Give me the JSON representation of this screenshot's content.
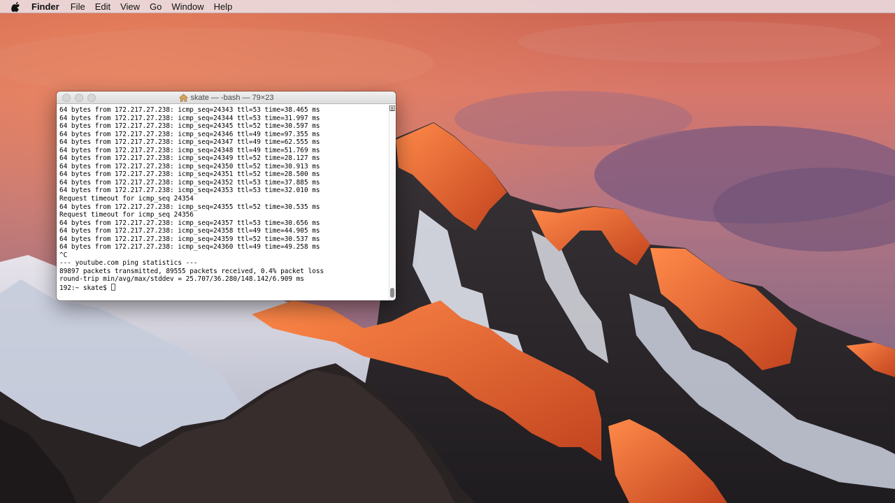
{
  "menubar": {
    "apple_icon": "apple-logo-icon",
    "app_name": "Finder",
    "items": [
      "File",
      "Edit",
      "View",
      "Go",
      "Window",
      "Help"
    ]
  },
  "terminal": {
    "title": "skate — -bash — 79×23",
    "title_icon": "home-folder-icon",
    "lines": [
      "64 bytes from 172.217.27.238: icmp_seq=24343 ttl=53 time=38.465 ms",
      "64 bytes from 172.217.27.238: icmp_seq=24344 ttl=53 time=31.997 ms",
      "64 bytes from 172.217.27.238: icmp_seq=24345 ttl=52 time=30.597 ms",
      "64 bytes from 172.217.27.238: icmp_seq=24346 ttl=49 time=97.355 ms",
      "64 bytes from 172.217.27.238: icmp_seq=24347 ttl=49 time=62.555 ms",
      "64 bytes from 172.217.27.238: icmp_seq=24348 ttl=49 time=51.769 ms",
      "64 bytes from 172.217.27.238: icmp_seq=24349 ttl=52 time=28.127 ms",
      "64 bytes from 172.217.27.238: icmp_seq=24350 ttl=52 time=30.913 ms",
      "64 bytes from 172.217.27.238: icmp_seq=24351 ttl=52 time=28.500 ms",
      "64 bytes from 172.217.27.238: icmp_seq=24352 ttl=53 time=37.885 ms",
      "64 bytes from 172.217.27.238: icmp_seq=24353 ttl=53 time=32.010 ms",
      "Request timeout for icmp_seq 24354",
      "64 bytes from 172.217.27.238: icmp_seq=24355 ttl=52 time=30.535 ms",
      "Request timeout for icmp_seq 24356",
      "64 bytes from 172.217.27.238: icmp_seq=24357 ttl=53 time=30.656 ms",
      "64 bytes from 172.217.27.238: icmp_seq=24358 ttl=49 time=44.905 ms",
      "64 bytes from 172.217.27.238: icmp_seq=24359 ttl=52 time=30.537 ms",
      "64 bytes from 172.217.27.238: icmp_seq=24360 ttl=49 time=49.258 ms",
      "^C",
      "--- youtube.com ping statistics ---",
      "89897 packets transmitted, 89555 packets received, 0.4% packet loss",
      "round-trip min/avg/max/stddev = 25.707/36.280/148.142/6.909 ms"
    ],
    "prompt": "192:~ skate$ "
  }
}
